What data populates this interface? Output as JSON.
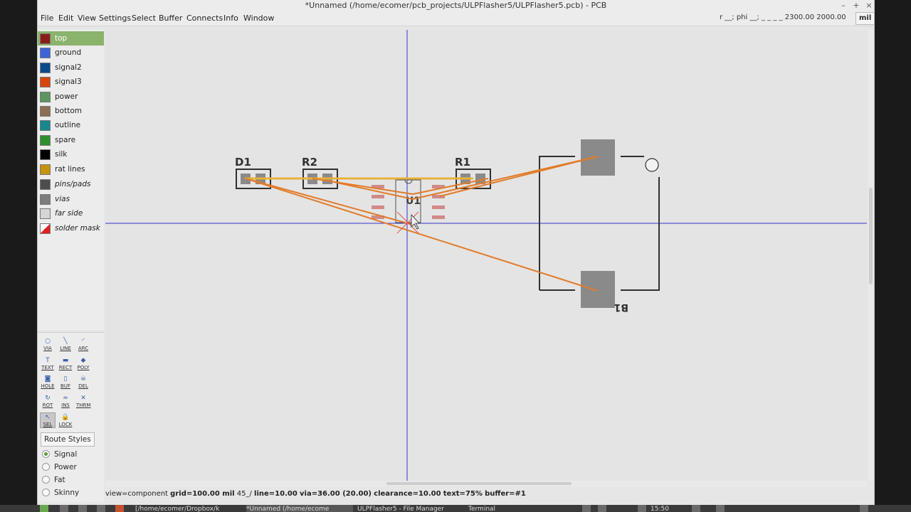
{
  "window": {
    "title": "*Unnamed (/home/ecomer/pcb_projects/ULPFlasher5/ULPFlasher5.pcb) - PCB",
    "controls": {
      "minimize": "–",
      "maximize": "+",
      "close": "×"
    }
  },
  "menubar": {
    "items": [
      "File",
      "Edit",
      "View",
      "Settings",
      "Select",
      "Buffer",
      "Connects",
      "Info",
      "Window"
    ],
    "cursor_readout": "r __; phi __; _ _ _ _  2300.00 2000.00",
    "units_label": "mil"
  },
  "layers": [
    {
      "name": "top",
      "color": "#8b1a1a",
      "italic": false,
      "selected": true
    },
    {
      "name": "ground",
      "color": "#3c64d8",
      "italic": false
    },
    {
      "name": "signal2",
      "color": "#0b4a8a",
      "italic": false
    },
    {
      "name": "signal3",
      "color": "#d8460c",
      "italic": false
    },
    {
      "name": "power",
      "color": "#5c9560",
      "italic": false
    },
    {
      "name": "bottom",
      "color": "#8d6e52",
      "italic": false
    },
    {
      "name": "outline",
      "color": "#17878c",
      "italic": false
    },
    {
      "name": "spare",
      "color": "#2e8f2e",
      "italic": false
    },
    {
      "name": "silk",
      "color": "#000000",
      "italic": false
    },
    {
      "name": "rat lines",
      "color": "#c8930c",
      "italic": false
    },
    {
      "name": "pins/pads",
      "color": "#4d4d4d",
      "italic": true
    },
    {
      "name": "vias",
      "color": "#7d7d7d",
      "italic": true
    },
    {
      "name": "far side",
      "color": "#d6d6d6",
      "italic": true
    },
    {
      "name": "solder mask",
      "color": "#ffffff",
      "italic": true
    }
  ],
  "tools": [
    {
      "label": "VIA",
      "icon": "via-icon",
      "glyph": "○"
    },
    {
      "label": "LINE",
      "icon": "line-icon",
      "glyph": "╲"
    },
    {
      "label": "ARC",
      "icon": "arc-icon",
      "glyph": "◜"
    },
    {
      "label": "TEXT",
      "icon": "text-icon",
      "glyph": "T"
    },
    {
      "label": "RECT",
      "icon": "rect-icon",
      "glyph": "▬"
    },
    {
      "label": "POLY",
      "icon": "poly-icon",
      "glyph": "◆"
    },
    {
      "label": "HOLE",
      "icon": "hole-icon",
      "glyph": "◙"
    },
    {
      "label": "BUF",
      "icon": "buffer-icon",
      "glyph": "▯"
    },
    {
      "label": "DEL",
      "icon": "delete-icon",
      "glyph": "☠"
    },
    {
      "label": "ROT",
      "icon": "rotate-icon",
      "glyph": "↻"
    },
    {
      "label": "INS",
      "icon": "insert-icon",
      "glyph": "≈"
    },
    {
      "label": "THRM",
      "icon": "thermal-icon",
      "glyph": "✕"
    },
    {
      "label": "SEL",
      "icon": "select-icon",
      "glyph": "↖",
      "active": true
    },
    {
      "label": "LOCK",
      "icon": "lock-icon",
      "glyph": "🔒"
    }
  ],
  "route_styles": {
    "button_label": "Route Styles",
    "options": [
      {
        "label": "Signal",
        "checked": true
      },
      {
        "label": "Power",
        "checked": false
      },
      {
        "label": "Fat",
        "checked": false
      },
      {
        "label": "Skinny",
        "checked": false
      }
    ]
  },
  "board": {
    "components": [
      {
        "refdes": "D1"
      },
      {
        "refdes": "R2"
      },
      {
        "refdes": "R1"
      },
      {
        "refdes": "U1"
      },
      {
        "refdes": "B1"
      }
    ]
  },
  "status": {
    "view": "view=component",
    "grid": "grid=100.00 mil",
    "angle": "45_/",
    "line": "line=10.00",
    "via": "via=36.00 (20.00)",
    "clearance": "clearance=10.00",
    "text": "text=75%",
    "buffer": "buffer=#1"
  },
  "taskbar": {
    "tasks": [
      {
        "label": "[/home/ecomer/Dropbox/k",
        "active": false
      },
      {
        "label": "*Unnamed (/home/ecome",
        "active": true
      },
      {
        "label": "ULPFlasher5 - File Manager",
        "active": false
      },
      {
        "label": "Terminal",
        "active": false
      }
    ],
    "clock": "15:50"
  }
}
